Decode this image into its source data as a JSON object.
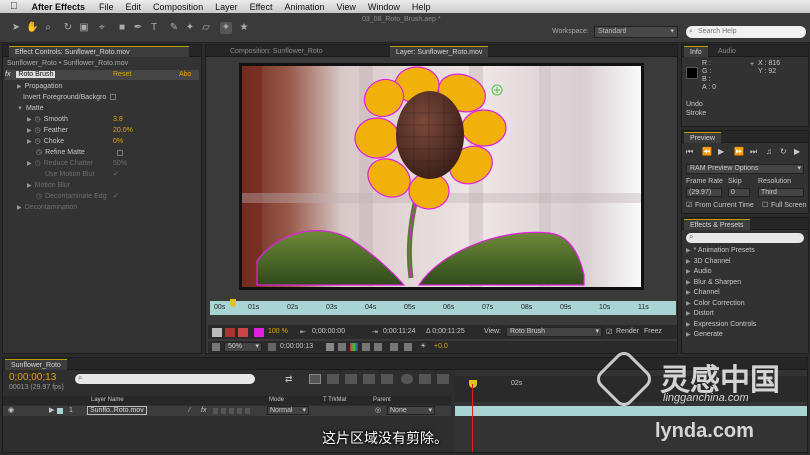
{
  "menubar": {
    "apple": "",
    "app": "After Effects",
    "items": [
      "File",
      "Edit",
      "Composition",
      "Layer",
      "Effect",
      "Animation",
      "View",
      "Window",
      "Help"
    ],
    "file_title": "03_08_Roto_Brush.aep *"
  },
  "toolbar": {
    "workspace_label": "Workspace:",
    "workspace_value": "Standard",
    "search_placeholder": "Search Help"
  },
  "effect_controls": {
    "tab": "Effect Controls: Sunflower_Roto.mov",
    "breadcrumb": "Sunflower_Roto • Sunflower_Roto.mov",
    "fx_name": "Roto Brush",
    "reset": "Reset",
    "about": "Abo",
    "propagation": "Propagation",
    "invert": "Invert Foreground/Backgro",
    "matte": "Matte",
    "smooth_label": "Smooth",
    "smooth_value": "3.8",
    "feather_label": "Feather",
    "feather_value": "20.0%",
    "choke_label": "Choke",
    "choke_value": "0%",
    "refine_matte": "Refine Matte",
    "reduce_chatter_label": "Reduce Chatter",
    "reduce_chatter_value": "50%",
    "use_motion_blur": "Use Motion Blur",
    "motion_blur": "Motion Blur",
    "decontaminate_edge": "Decontaminate Edg",
    "decontamination": "Decontamination"
  },
  "composition_tab": "Composition: Sunflower_Roto",
  "layer_tab": "Layer: Sunflower_Roto.mov",
  "layer_viewer": {
    "ruler_labels": [
      "00s",
      "01s",
      "02s",
      "03s",
      "04s",
      "05s",
      "06s",
      "07s",
      "08s",
      "09s",
      "10s",
      "11s"
    ],
    "zoom": "100 %",
    "time_start": "0;00:00:00",
    "time_end": "0;00:11:24",
    "duration": "Δ 0;00:11:25",
    "view_label": "View:",
    "view_value": "Roto Brush",
    "render_label": "Render",
    "freeze_label": "Freez",
    "magnification": "50%",
    "current_time": "0;00:00:13",
    "exposure": "+0.0"
  },
  "info": {
    "tab_info": "Info",
    "tab_audio": "Audio",
    "r": "R :",
    "g": "G :",
    "b": "B :",
    "a": "A : 0",
    "x": "X : 816",
    "y": "Y : 92",
    "undo": "Undo",
    "stroke": "Stroke"
  },
  "preview": {
    "tab": "Preview",
    "ram_options": "RAM Preview Options",
    "frame_rate_label": "Frame Rate",
    "skip_label": "Skip",
    "resolution_label": "Resolution",
    "frame_rate": "(29.97)",
    "skip": "0",
    "resolution": "Third",
    "from_current": "From Current Time",
    "full_screen": "Full Screen"
  },
  "effects_presets": {
    "tab": "Effects & Presets",
    "search_placeholder": "",
    "items": [
      "* Animation Presets",
      "3D Channel",
      "Audio",
      "Blur & Sharpen",
      "Channel",
      "Color Correction",
      "Distort",
      "Expression Controls",
      "Generate"
    ]
  },
  "timeline": {
    "tab": "Sunflower_Roto",
    "timecode": "0;00;00;13",
    "fps": "00013 (29.97 fps)",
    "col_layer_name": "Layer Name",
    "col_mode": "Mode",
    "col_trkmat": "T TrkMat",
    "col_parent": "Parent",
    "layer_number": "1",
    "layer_name": "Sunflo..Roto.mov",
    "layer_mode": "Normal",
    "layer_parent": "None",
    "ruler_label": "02s"
  },
  "overlay": {
    "subtitle": "这片区域没有剪除。",
    "watermark_cn": "灵感中国",
    "watermark_url": "lingganchina.com",
    "watermark_lynda": "lynda.com"
  },
  "colors": {
    "accent": "#e2a400",
    "timeline_bar": "#a9d4d4",
    "playhead": "#e02020",
    "roto_outline": "#e020e0"
  }
}
